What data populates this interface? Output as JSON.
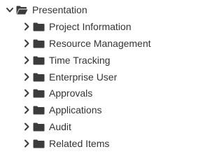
{
  "tree": {
    "root": {
      "label": "Presentation",
      "expanded": true,
      "icon": "folder-open-icon"
    },
    "children": [
      {
        "label": "Project Information",
        "expanded": false,
        "icon": "folder-icon"
      },
      {
        "label": "Resource Management",
        "expanded": false,
        "icon": "folder-icon"
      },
      {
        "label": "Time Tracking",
        "expanded": false,
        "icon": "folder-icon"
      },
      {
        "label": "Enterprise User",
        "expanded": false,
        "icon": "folder-icon"
      },
      {
        "label": "Approvals",
        "expanded": false,
        "icon": "folder-icon"
      },
      {
        "label": "Applications",
        "expanded": false,
        "icon": "folder-icon"
      },
      {
        "label": "Audit",
        "expanded": false,
        "icon": "folder-icon"
      },
      {
        "label": "Related Items",
        "expanded": false,
        "icon": "folder-icon"
      }
    ]
  },
  "colors": {
    "text": "#333333",
    "icon": "#3c3c3c",
    "background": "#ffffff"
  }
}
